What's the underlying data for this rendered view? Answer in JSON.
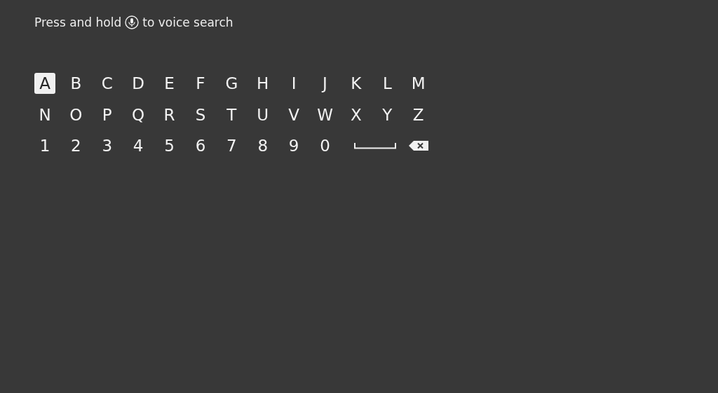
{
  "hint": {
    "before": "Press and hold",
    "after": "to voice search"
  },
  "keyboard": {
    "rows": [
      {
        "keys": [
          {
            "kind": "char",
            "label": "A",
            "selected": true
          },
          {
            "kind": "char",
            "label": "B",
            "selected": false
          },
          {
            "kind": "char",
            "label": "C",
            "selected": false
          },
          {
            "kind": "char",
            "label": "D",
            "selected": false
          },
          {
            "kind": "char",
            "label": "E",
            "selected": false
          },
          {
            "kind": "char",
            "label": "F",
            "selected": false
          },
          {
            "kind": "char",
            "label": "G",
            "selected": false
          },
          {
            "kind": "char",
            "label": "H",
            "selected": false
          },
          {
            "kind": "char",
            "label": "I",
            "selected": false
          },
          {
            "kind": "char",
            "label": "J",
            "selected": false
          },
          {
            "kind": "char",
            "label": "K",
            "selected": false
          },
          {
            "kind": "char",
            "label": "L",
            "selected": false
          },
          {
            "kind": "char",
            "label": "M",
            "selected": false
          }
        ]
      },
      {
        "keys": [
          {
            "kind": "char",
            "label": "N",
            "selected": false
          },
          {
            "kind": "char",
            "label": "O",
            "selected": false
          },
          {
            "kind": "char",
            "label": "P",
            "selected": false
          },
          {
            "kind": "char",
            "label": "Q",
            "selected": false
          },
          {
            "kind": "char",
            "label": "R",
            "selected": false
          },
          {
            "kind": "char",
            "label": "S",
            "selected": false
          },
          {
            "kind": "char",
            "label": "T",
            "selected": false
          },
          {
            "kind": "char",
            "label": "U",
            "selected": false
          },
          {
            "kind": "char",
            "label": "V",
            "selected": false
          },
          {
            "kind": "char",
            "label": "W",
            "selected": false
          },
          {
            "kind": "char",
            "label": "X",
            "selected": false
          },
          {
            "kind": "char",
            "label": "Y",
            "selected": false
          },
          {
            "kind": "char",
            "label": "Z",
            "selected": false
          }
        ]
      },
      {
        "keys": [
          {
            "kind": "char",
            "label": "1",
            "selected": false
          },
          {
            "kind": "char",
            "label": "2",
            "selected": false
          },
          {
            "kind": "char",
            "label": "3",
            "selected": false
          },
          {
            "kind": "char",
            "label": "4",
            "selected": false
          },
          {
            "kind": "char",
            "label": "5",
            "selected": false
          },
          {
            "kind": "char",
            "label": "6",
            "selected": false
          },
          {
            "kind": "char",
            "label": "7",
            "selected": false
          },
          {
            "kind": "char",
            "label": "8",
            "selected": false
          },
          {
            "kind": "char",
            "label": "9",
            "selected": false
          },
          {
            "kind": "char",
            "label": "0",
            "selected": false
          },
          {
            "kind": "space",
            "selected": false
          },
          {
            "kind": "backspace",
            "selected": false
          }
        ]
      }
    ]
  }
}
